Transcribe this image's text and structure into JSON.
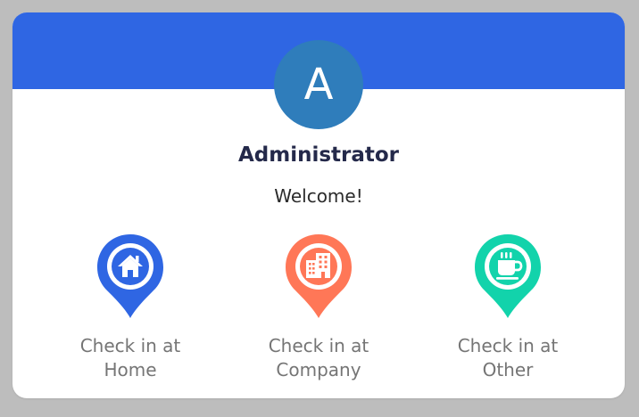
{
  "user": {
    "avatar_letter": "A",
    "name": "Administrator",
    "welcome": "Welcome!"
  },
  "checkins": [
    {
      "label": "Check in at\nHome",
      "icon": "home-icon",
      "color": "#2f66e3"
    },
    {
      "label": "Check in at\nCompany",
      "icon": "building-icon",
      "color": "#ff7757"
    },
    {
      "label": "Check in at\nOther",
      "icon": "coffee-cup-icon",
      "color": "#12d3ab"
    }
  ],
  "colors": {
    "header": "#2f66e3",
    "avatar": "#2f7dbb",
    "name_text": "#24294a",
    "label_text": "#757575"
  }
}
